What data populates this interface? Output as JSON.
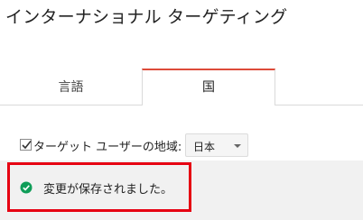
{
  "page": {
    "title": "インターナショナル ターゲティング"
  },
  "tabs": [
    {
      "label": "言語",
      "selected": false
    },
    {
      "label": "国",
      "selected": true
    }
  ],
  "country_targeting": {
    "checked": true,
    "label": "ターゲット ユーザーの地域:",
    "selected_country": "日本"
  },
  "status": {
    "message": "変更が保存されました。",
    "icon": "check-circle-icon"
  },
  "colors": {
    "active_tab_accent": "#dd4b39",
    "success": "#0f9d58",
    "highlight": "#e60012",
    "panel_background": "#f1f1f1"
  }
}
